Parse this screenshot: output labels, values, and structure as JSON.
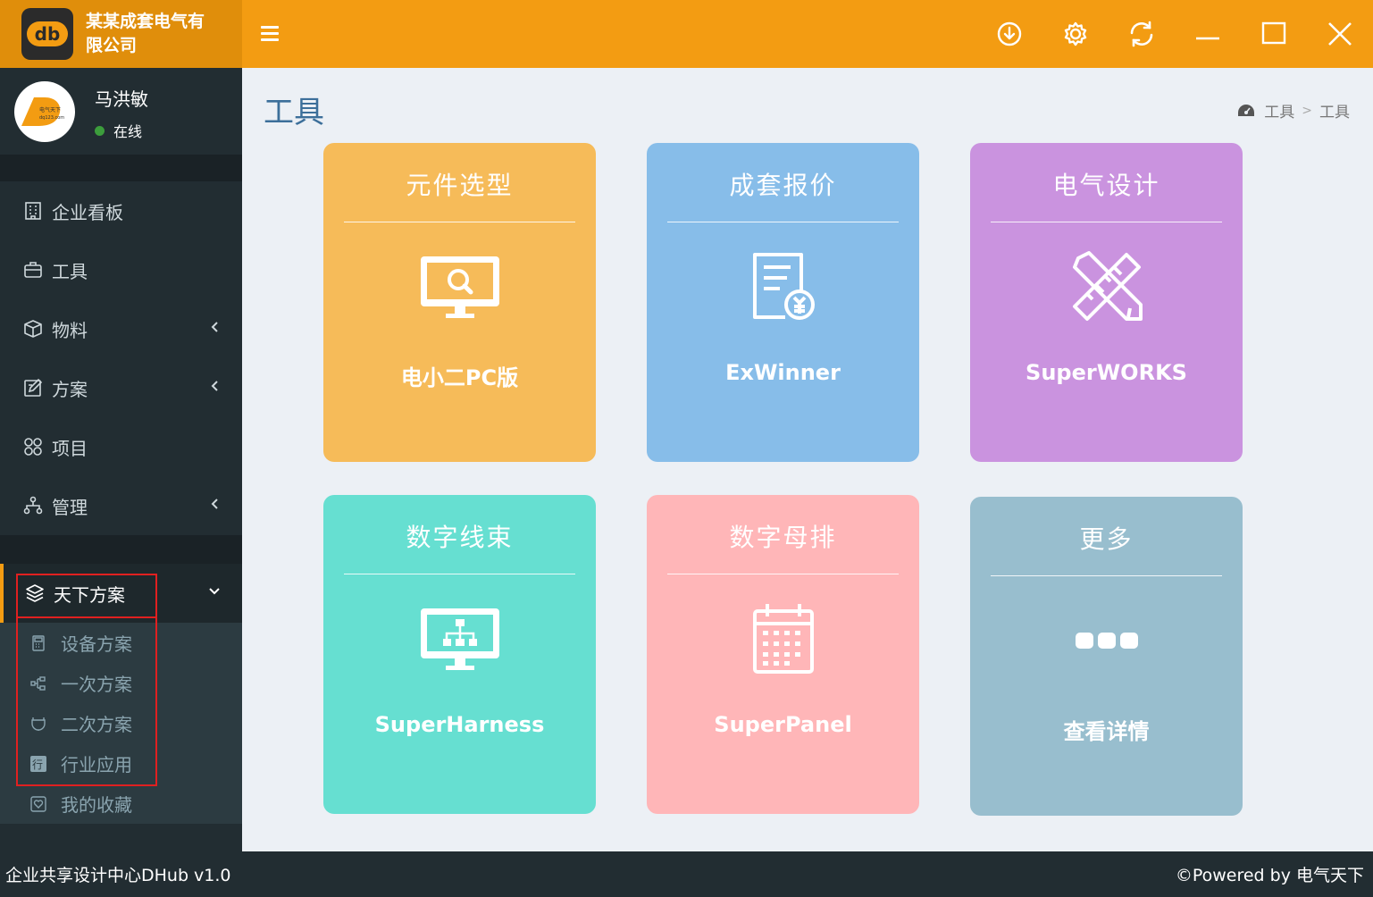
{
  "app": {
    "logo_text": "db",
    "company_name": "某某成套电气有限公司",
    "accent_color": "#f39c12"
  },
  "user": {
    "name": "马洪敏",
    "status": "在线",
    "avatar_text": "电气天下 dq123.com"
  },
  "sidebar": {
    "items": [
      {
        "label": "企业看板",
        "icon": "building-icon"
      },
      {
        "label": "工具",
        "icon": "briefcase-icon"
      },
      {
        "label": "物料",
        "icon": "cube-icon",
        "has_children": true
      },
      {
        "label": "方案",
        "icon": "edit-icon",
        "has_children": true
      },
      {
        "label": "项目",
        "icon": "grid-icon"
      },
      {
        "label": "管理",
        "icon": "sitemap-icon",
        "has_children": true
      }
    ],
    "expanded": {
      "label": "天下方案",
      "icon": "layers-icon",
      "children": [
        {
          "label": "设备方案",
          "icon": "calculator-icon"
        },
        {
          "label": "一次方案",
          "icon": "diagram-icon"
        },
        {
          "label": "二次方案",
          "icon": "plug-icon"
        },
        {
          "label": "行业应用",
          "icon": "hang-icon"
        },
        {
          "label": "我的收藏",
          "icon": "heart-icon"
        }
      ]
    }
  },
  "main": {
    "title": "工具",
    "breadcrumb": [
      "工具",
      "工具"
    ],
    "tiles": [
      {
        "title": "元件选型",
        "label": "电小二PC版",
        "icon": "monitor-search-icon",
        "color": "#f6bb59"
      },
      {
        "title": "成套报价",
        "label": "ExWinner",
        "icon": "invoice-yen-icon",
        "color": "#87bde9"
      },
      {
        "title": "电气设计",
        "label": "SuperWORKS",
        "icon": "pencil-ruler-icon",
        "color": "#ca93df"
      },
      {
        "title": "数字线束",
        "label": "SuperHarness",
        "icon": "monitor-network-icon",
        "color": "#66dfd1"
      },
      {
        "title": "数字母排",
        "label": "SuperPanel",
        "icon": "calendar-icon",
        "color": "#ffb6b8"
      },
      {
        "title": "更多",
        "label": "查看详情",
        "icon": "more-dots-icon",
        "color": "#98bece"
      }
    ]
  },
  "footer": {
    "left": "企业共享设计中心DHub v1.0",
    "right": "©Powered by 电气天下"
  }
}
